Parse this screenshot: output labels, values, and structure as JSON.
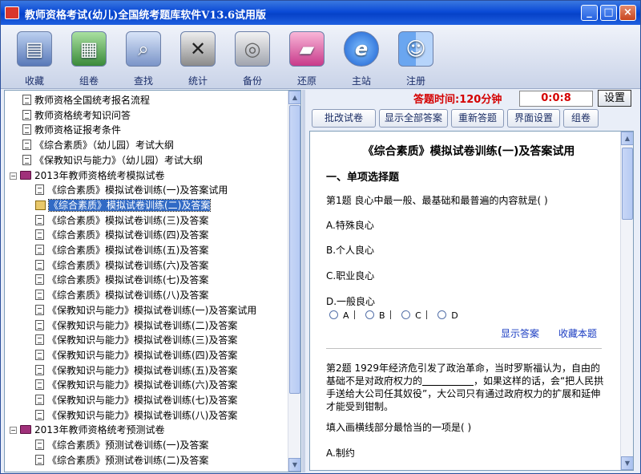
{
  "window": {
    "title": "教师资格考试(幼儿)全国统考题库软件V13.6试用版",
    "controls": {
      "minimize": "_",
      "maximize": "□",
      "close": "×"
    }
  },
  "toolbar": {
    "items": [
      {
        "label": "收藏",
        "icon": "collection-icon"
      },
      {
        "label": "组卷",
        "icon": "compose-icon"
      },
      {
        "label": "查找",
        "icon": "search-icon"
      },
      {
        "label": "统计",
        "icon": "statistics-icon"
      },
      {
        "label": "备份",
        "icon": "backup-icon"
      },
      {
        "label": "还原",
        "icon": "restore-icon"
      },
      {
        "label": "主站",
        "icon": "website-icon"
      },
      {
        "label": "注册",
        "icon": "register-icon"
      }
    ]
  },
  "tree": {
    "nodes": [
      {
        "label": "教师资格全国统考报名流程",
        "level": 0,
        "type": "doc"
      },
      {
        "label": "教师资格统考知识问答",
        "level": 0,
        "type": "doc"
      },
      {
        "label": "教师资格证报考条件",
        "level": 0,
        "type": "doc"
      },
      {
        "label": "《综合素质》（幼儿园）考试大纲",
        "level": 0,
        "type": "doc"
      },
      {
        "label": "《保教知识与能力》（幼儿园）考试大纲",
        "level": 0,
        "type": "doc"
      },
      {
        "label": "2013年教师资格统考模拟试卷",
        "level": 0,
        "type": "folder",
        "expander": "−"
      },
      {
        "label": "《综合素质》模拟试卷训练(一)及答案试用",
        "level": 1,
        "type": "doc"
      },
      {
        "label": "《综合素质》模拟试卷训练(二)及答案",
        "level": 1,
        "type": "open",
        "selected": true
      },
      {
        "label": "《综合素质》模拟试卷训练(三)及答案",
        "level": 1,
        "type": "doc"
      },
      {
        "label": "《综合素质》模拟试卷训练(四)及答案",
        "level": 1,
        "type": "doc"
      },
      {
        "label": "《综合素质》模拟试卷训练(五)及答案",
        "level": 1,
        "type": "doc"
      },
      {
        "label": "《综合素质》模拟试卷训练(六)及答案",
        "level": 1,
        "type": "doc"
      },
      {
        "label": "《综合素质》模拟试卷训练(七)及答案",
        "level": 1,
        "type": "doc"
      },
      {
        "label": "《综合素质》模拟试卷训练(八)及答案",
        "level": 1,
        "type": "doc"
      },
      {
        "label": "《保教知识与能力》模拟试卷训练(一)及答案试用",
        "level": 1,
        "type": "doc"
      },
      {
        "label": "《保教知识与能力》模拟试卷训练(二)及答案",
        "level": 1,
        "type": "doc"
      },
      {
        "label": "《保教知识与能力》模拟试卷训练(三)及答案",
        "level": 1,
        "type": "doc"
      },
      {
        "label": "《保教知识与能力》模拟试卷训练(四)及答案",
        "level": 1,
        "type": "doc"
      },
      {
        "label": "《保教知识与能力》模拟试卷训练(五)及答案",
        "level": 1,
        "type": "doc"
      },
      {
        "label": "《保教知识与能力》模拟试卷训练(六)及答案",
        "level": 1,
        "type": "doc"
      },
      {
        "label": "《保教知识与能力》模拟试卷训练(七)及答案",
        "level": 1,
        "type": "doc"
      },
      {
        "label": "《保教知识与能力》模拟试卷训练(八)及答案",
        "level": 1,
        "type": "doc"
      },
      {
        "label": "2013年教师资格统考预测试卷",
        "level": 0,
        "type": "folder",
        "expander": "−"
      },
      {
        "label": "《综合素质》预测试卷训练(一)及答案",
        "level": 1,
        "type": "doc"
      },
      {
        "label": "《综合素质》预测试卷训练(二)及答案",
        "level": 1,
        "type": "doc"
      }
    ]
  },
  "exam": {
    "timer_label": "答题时间:120分钟",
    "elapsed": "0:0:8",
    "settings": "设置",
    "actions": [
      "批改试卷",
      "显示全部答案",
      "重新答题",
      "界面设置",
      "组卷"
    ]
  },
  "paper": {
    "title": "《综合素质》模拟试卷训练(一)及答案试用",
    "section": "一、单项选择题",
    "q1": {
      "stem": "第1题 良心中最一般、最基础和最普遍的内容就是( )",
      "options": [
        "A.特殊良心",
        "B.个人良心",
        "C.职业良心",
        "D.一般良心"
      ],
      "choices": [
        "A",
        "B",
        "C",
        "D"
      ],
      "show_answer": "显示答案",
      "bookmark": "收藏本题"
    },
    "q2": {
      "stem_a": "第2题 1929年经济危引发了政治革命，当时罗斯福认为，自由的基础不是对政府权力的",
      "stem_b": "，如果这样的话，会“把人民拱手送给大公司任其奴役”，大公司只有通过政府权力的扩展和延伸才能受到钳制。",
      "ask": "填入画横线部分最恰当的一项是( )",
      "option_partial": "A.制约"
    }
  }
}
